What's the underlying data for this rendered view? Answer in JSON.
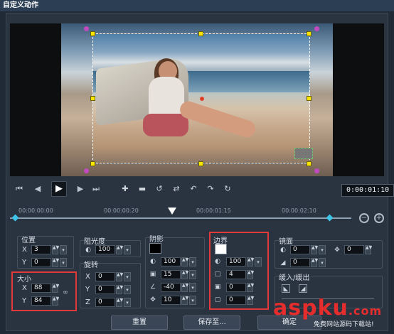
{
  "window": {
    "title": "自定义动作"
  },
  "transport": {
    "timecode": "0:00:01:10"
  },
  "ruler": {
    "labels": [
      "00:00:00:00",
      "00:00:00:20",
      "00:00:01:15",
      "00:00:02:10"
    ]
  },
  "position": {
    "title": "位置",
    "x_label": "X",
    "x_value": "3",
    "y_label": "Y",
    "y_value": "0"
  },
  "size": {
    "title": "大小",
    "x_label": "X",
    "x_value": "88",
    "y_label": "Y",
    "y_value": "84"
  },
  "opacity": {
    "title": "阻光度",
    "value": "100"
  },
  "rotation": {
    "title": "旋转",
    "x_label": "X",
    "x_value": "0",
    "y_label": "Y",
    "y_value": "0",
    "z_label": "Z",
    "z_value": "0"
  },
  "shadow": {
    "title": "阴影",
    "color": "#000000",
    "opacity": "100",
    "blur": "15",
    "angle": "-40",
    "distance": "10"
  },
  "border": {
    "title": "边界",
    "color": "#ffffff",
    "opacity": "100",
    "width": "4",
    "val2": "0",
    "val3": "0"
  },
  "mirror": {
    "title": "镜面",
    "val1": "0",
    "val2": "0",
    "val3": "0",
    "val4": "0"
  },
  "fade": {
    "title": "缓入/缓出"
  },
  "buttons": {
    "reset": "重置",
    "save_to": "保存至...",
    "ok": "确定"
  },
  "watermark": {
    "main": "aspku",
    "suffix": ".com",
    "sub": "免费网站源码下载站!"
  }
}
